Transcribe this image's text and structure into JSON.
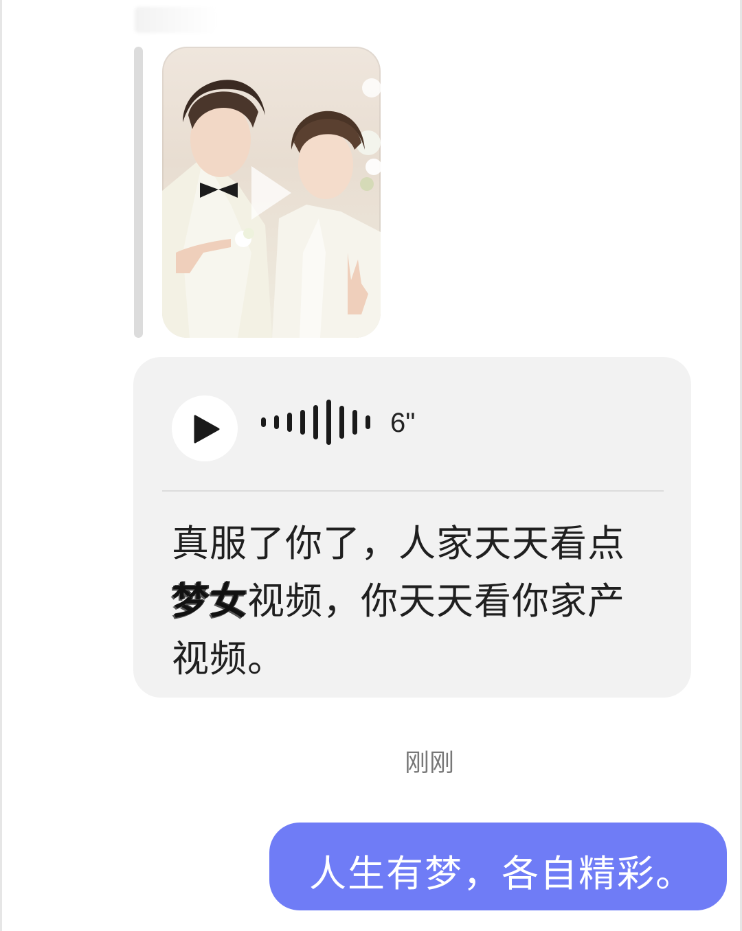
{
  "chat": {
    "incoming": {
      "video": {
        "play_icon": "play-triangle-icon"
      },
      "voice_message": {
        "play_icon": "play-icon",
        "waveform_icon": "audio-waveform-icon",
        "duration": "6\"",
        "transcript_line1": "真服了你了，人家天天看点",
        "transcript_line2_scribble": "梦女",
        "transcript_line2": "视频，你天天看你家产",
        "transcript_line3": "视频。"
      }
    },
    "timestamp": "刚刚",
    "outgoing": {
      "text": "人生有梦，各自精彩。",
      "bubble_color": "#6f7cf6"
    }
  }
}
